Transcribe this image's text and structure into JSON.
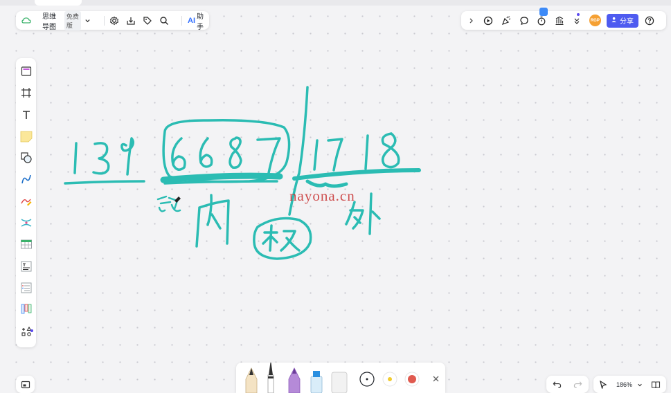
{
  "toolbar_left": {
    "title": "思维导图",
    "plan_badge": "免费版",
    "ai_label": "AI",
    "ai_assistant": "助手"
  },
  "toolbar_right": {
    "avatar_text": "RGP",
    "share_label": "分享"
  },
  "zoom": {
    "value": "186%"
  },
  "watermark": "nayona.cn",
  "colors": {
    "accent": "#4e5bf0",
    "ink": "#2bbcb3",
    "avatar": "#f5a033"
  },
  "left_tools": [
    "template-icon",
    "frame-icon",
    "text-icon",
    "sticky-note-icon",
    "shape-icon",
    "connector-icon",
    "pen-icon",
    "mindmap-icon",
    "table-icon",
    "text-doc-icon",
    "list-icon",
    "kanban-icon",
    "more-apps-icon"
  ]
}
